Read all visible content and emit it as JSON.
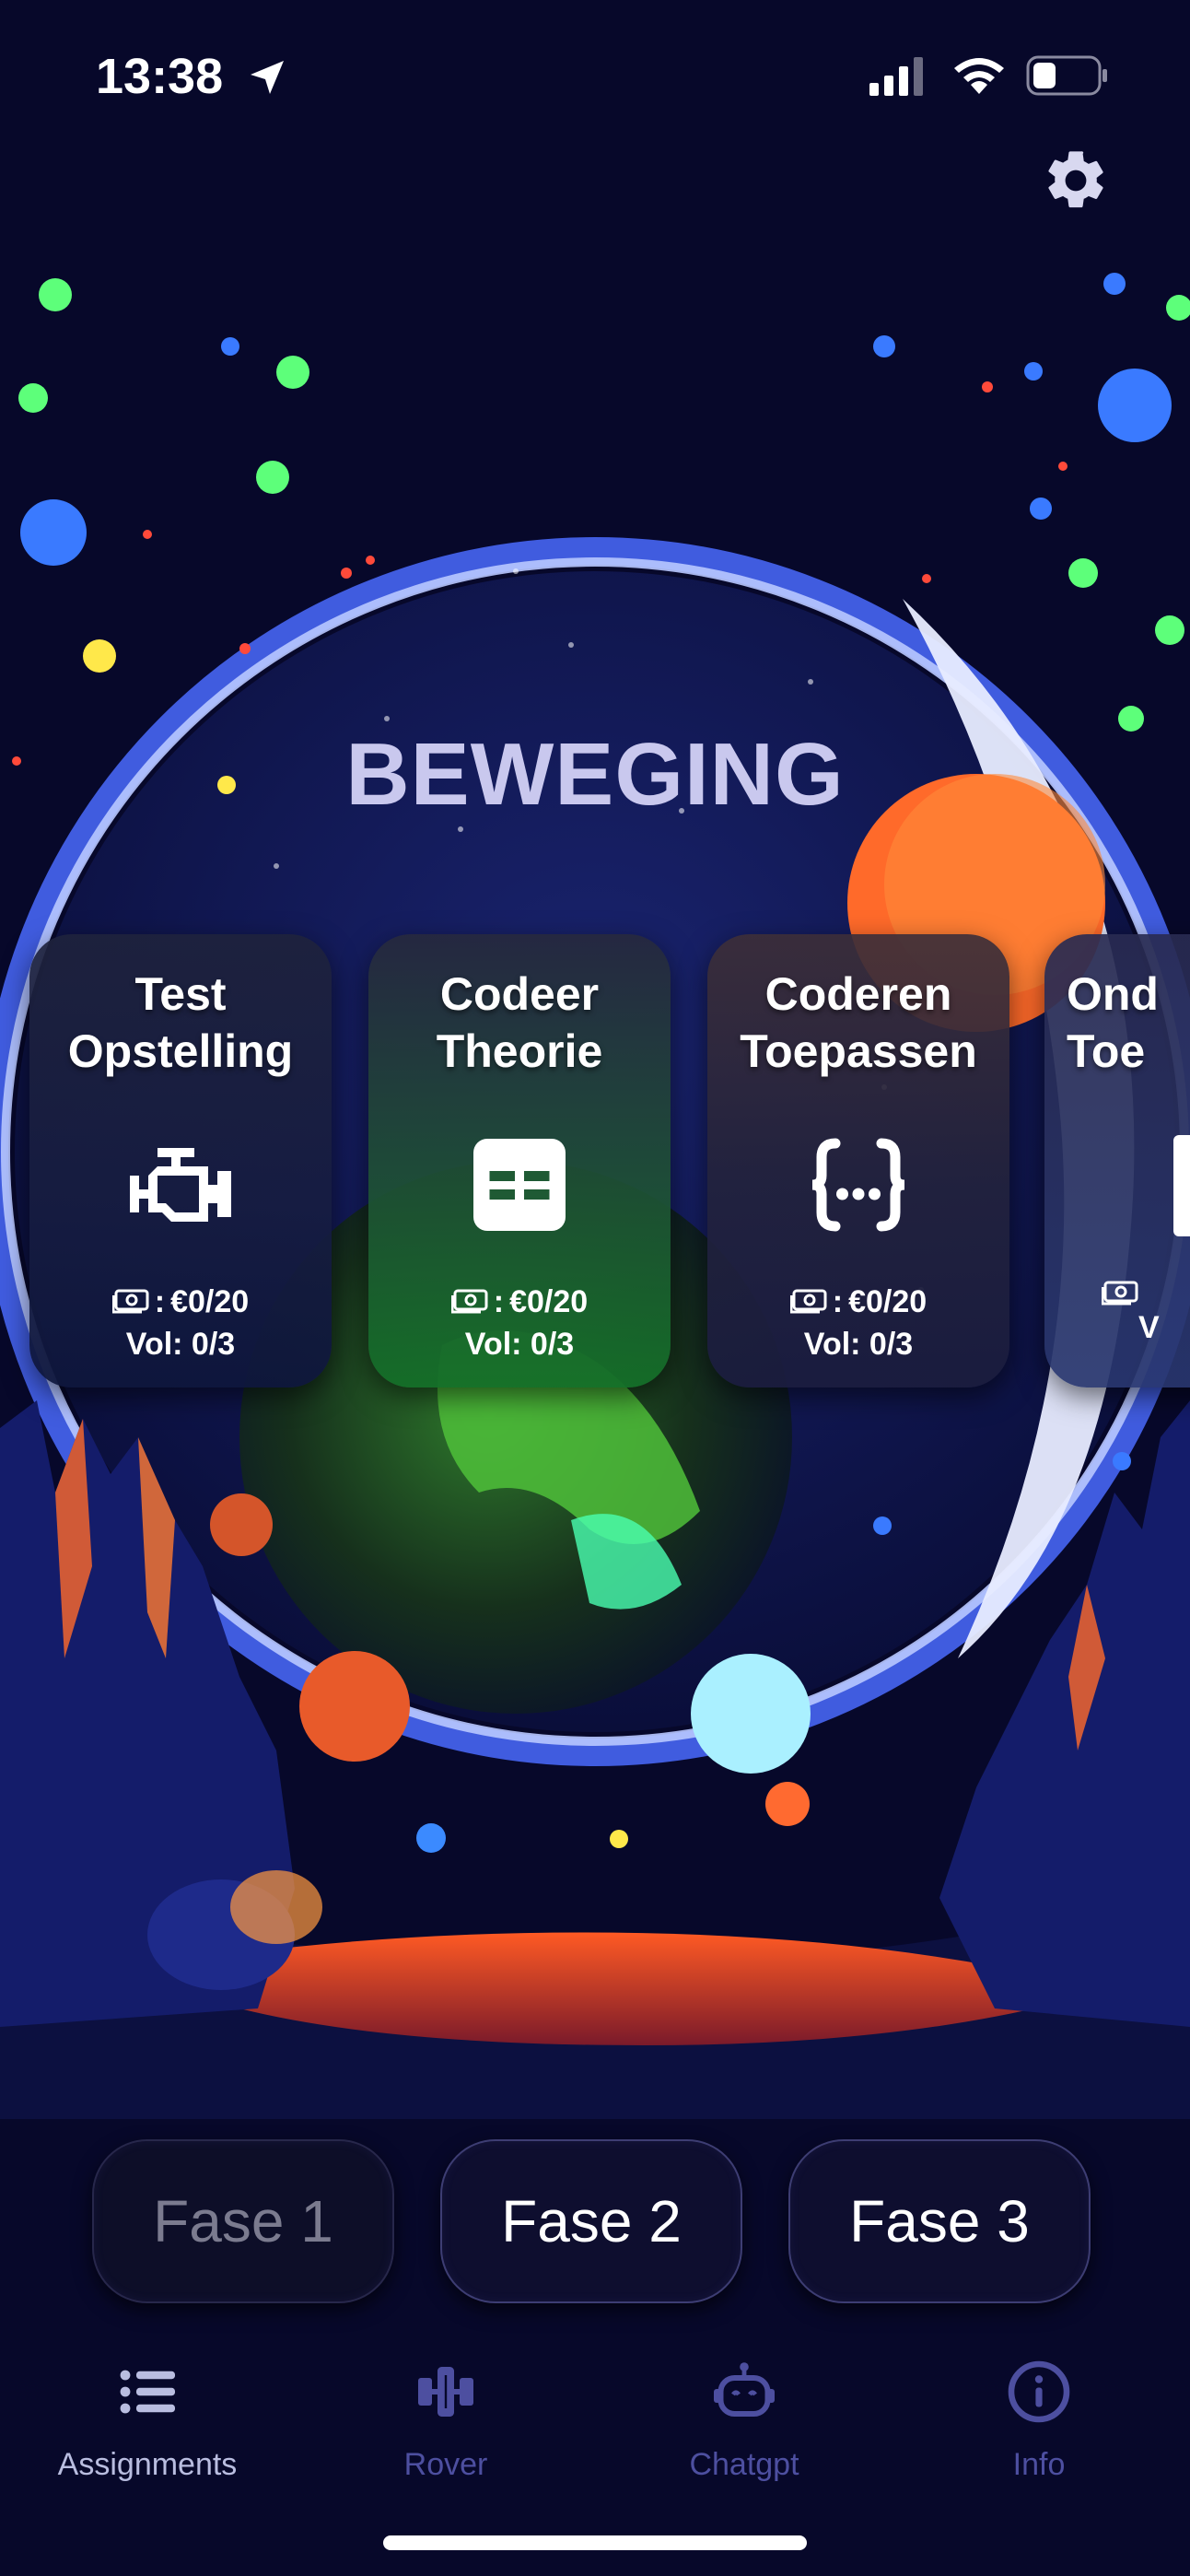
{
  "status_bar": {
    "time": "13:38"
  },
  "section": {
    "title": "BEWEGING"
  },
  "cards": [
    {
      "title_line1": "Test",
      "title_line2": "Opstelling",
      "icon": "engine-icon",
      "money": "€0/20",
      "vol": "Vol: 0/3"
    },
    {
      "title_line1": "Codeer",
      "title_line2": "Theorie",
      "icon": "table-icon",
      "money": "€0/20",
      "vol": "Vol: 0/3"
    },
    {
      "title_line1": "Coderen",
      "title_line2": "Toepassen",
      "icon": "code-braces-icon",
      "money": "€0/20",
      "vol": "Vol: 0/3"
    },
    {
      "title_line1": "Ond",
      "title_line2": "Toe",
      "icon": "partial-icon",
      "money": "",
      "vol": "V"
    }
  ],
  "money_prefix": ":",
  "phases": [
    {
      "label": "Fase 1",
      "state": "disabled"
    },
    {
      "label": "Fase 2",
      "state": "enabled"
    },
    {
      "label": "Fase 3",
      "state": "enabled"
    }
  ],
  "tabs": [
    {
      "label": "Assignments",
      "icon": "list-icon",
      "active": true
    },
    {
      "label": "Rover",
      "icon": "satellite-icon",
      "active": false
    },
    {
      "label": "Chatgpt",
      "icon": "robot-icon",
      "active": false
    },
    {
      "label": "Info",
      "icon": "info-icon",
      "active": false
    }
  ],
  "colors": {
    "background": "#07082a",
    "title": "#c9c8ee",
    "tab_active": "#b9bde0",
    "tab_inactive": "#4d4fa0"
  }
}
